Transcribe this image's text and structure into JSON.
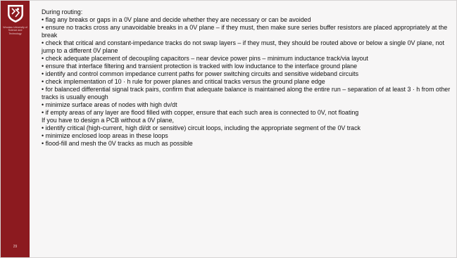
{
  "sidebar": {
    "university_name": "Wrocław University of Science and Technology",
    "page_number": "29",
    "logo": "university-crest-icon"
  },
  "colors": {
    "accent": "#8c1a1f",
    "background": "#f7f6f6"
  },
  "content": {
    "heading": "During routing:",
    "lines": [
      "• flag any breaks or gaps in a 0V plane and decide whether they are necessary or can be avoided",
      "• ensure no tracks cross any unavoidable breaks in a 0V plane – if they must, then make sure series buffer resistors are placed appropriately at the break",
      "• check that critical and constant-impedance tracks do not swap layers – if they must, they should be routed above or below a single 0V plane, not jump to a different 0V plane",
      "• check adequate placement of decoupling capacitors – near device power pins – minimum inductance track/via layout",
      "• ensure that interface filtering and transient protection is tracked with low inductance to the interface ground plane",
      "• identify and control common impedance current paths for power switching circuits and sensitive wideband circuits",
      "• check implementation of 10 · h rule for power planes and critical tracks versus the ground plane edge",
      "• for balanced differential signal track pairs, confirm that adequate balance is maintained along the entire run – separation of at least 3 · h from other tracks is usually enough",
      "• minimize surface areas of nodes with high dv/dt",
      "• if empty areas of any layer are flood filled with copper, ensure that each such area is connected to 0V, not floating",
      "If you have to design a PCB without a 0V plane,",
      "• identify critical (high-current, high di/dt or sensitive) circuit loops, including the appropriate segment of the 0V track",
      "• minimize enclosed loop areas in these loops",
      "• flood-fill and mesh the 0V tracks as much as possible"
    ]
  }
}
